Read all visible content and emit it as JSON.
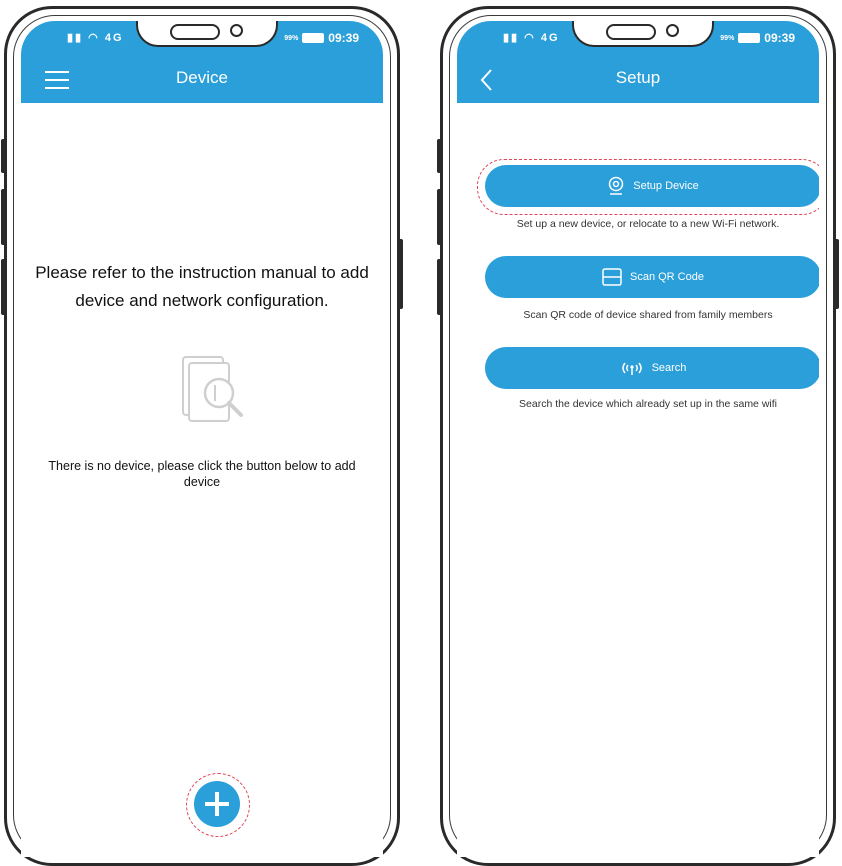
{
  "status_bar": {
    "signal": "4G",
    "network": "4G",
    "battery": "99%",
    "time": "09:39"
  },
  "device_screen": {
    "title": "Device",
    "instruction": "Please refer to the instruction manual to add device and network configuration.",
    "empty_message": "There is no device, please click the button below to add device",
    "add_button_icon": "plus-icon",
    "menu_icon": "hamburger-menu-icon",
    "empty_icon": "device-search-icon"
  },
  "setup_screen": {
    "title": "Setup",
    "back_icon": "chevron-left-icon",
    "options": [
      {
        "label": "Setup Device",
        "icon": "camera-icon",
        "description": "Set up a new device, or relocate to a new Wi-Fi network."
      },
      {
        "label": "Scan QR Code",
        "icon": "qr-frame-icon",
        "description": "Scan QR code of device shared from family members"
      },
      {
        "label": "Search",
        "icon": "radar-signal-icon",
        "description": "Search the device which already set up in the same wifi"
      }
    ]
  },
  "colors": {
    "accent": "#2b9fd9",
    "highlight": "#e0455a"
  }
}
